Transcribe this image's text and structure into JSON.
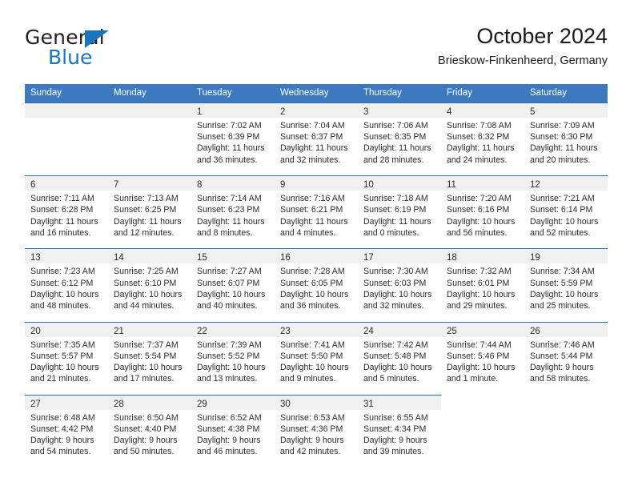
{
  "brand": {
    "name_top": "General",
    "name_bottom": "Blue",
    "triangle_color": "#1b75bb"
  },
  "header": {
    "title": "October 2024",
    "subtitle": "Brieskow-Finkenheerd, Germany"
  },
  "theme": {
    "header_blue": "#3c79bf",
    "row_border_blue": "#2f6cb2",
    "day_bar_gray": "#f0f0f0",
    "text": "#2b2b2b"
  },
  "weekdays": [
    "Sunday",
    "Monday",
    "Tuesday",
    "Wednesday",
    "Thursday",
    "Friday",
    "Saturday"
  ],
  "labels": {
    "sunrise_prefix": "Sunrise: ",
    "sunset_prefix": "Sunset: ",
    "daylight_prefix": "Daylight: "
  },
  "weeks": [
    [
      {
        "day": "",
        "blank": true
      },
      {
        "day": "",
        "blank": true
      },
      {
        "day": "1",
        "sunrise": "Sunrise: 7:02 AM",
        "sunset": "Sunset: 6:39 PM",
        "daylight_1": "Daylight: 11 hours",
        "daylight_2": "and 36 minutes."
      },
      {
        "day": "2",
        "sunrise": "Sunrise: 7:04 AM",
        "sunset": "Sunset: 6:37 PM",
        "daylight_1": "Daylight: 11 hours",
        "daylight_2": "and 32 minutes."
      },
      {
        "day": "3",
        "sunrise": "Sunrise: 7:06 AM",
        "sunset": "Sunset: 6:35 PM",
        "daylight_1": "Daylight: 11 hours",
        "daylight_2": "and 28 minutes."
      },
      {
        "day": "4",
        "sunrise": "Sunrise: 7:08 AM",
        "sunset": "Sunset: 6:32 PM",
        "daylight_1": "Daylight: 11 hours",
        "daylight_2": "and 24 minutes."
      },
      {
        "day": "5",
        "sunrise": "Sunrise: 7:09 AM",
        "sunset": "Sunset: 6:30 PM",
        "daylight_1": "Daylight: 11 hours",
        "daylight_2": "and 20 minutes."
      }
    ],
    [
      {
        "day": "6",
        "sunrise": "Sunrise: 7:11 AM",
        "sunset": "Sunset: 6:28 PM",
        "daylight_1": "Daylight: 11 hours",
        "daylight_2": "and 16 minutes."
      },
      {
        "day": "7",
        "sunrise": "Sunrise: 7:13 AM",
        "sunset": "Sunset: 6:25 PM",
        "daylight_1": "Daylight: 11 hours",
        "daylight_2": "and 12 minutes."
      },
      {
        "day": "8",
        "sunrise": "Sunrise: 7:14 AM",
        "sunset": "Sunset: 6:23 PM",
        "daylight_1": "Daylight: 11 hours",
        "daylight_2": "and 8 minutes."
      },
      {
        "day": "9",
        "sunrise": "Sunrise: 7:16 AM",
        "sunset": "Sunset: 6:21 PM",
        "daylight_1": "Daylight: 11 hours",
        "daylight_2": "and 4 minutes."
      },
      {
        "day": "10",
        "sunrise": "Sunrise: 7:18 AM",
        "sunset": "Sunset: 6:19 PM",
        "daylight_1": "Daylight: 11 hours",
        "daylight_2": "and 0 minutes."
      },
      {
        "day": "11",
        "sunrise": "Sunrise: 7:20 AM",
        "sunset": "Sunset: 6:16 PM",
        "daylight_1": "Daylight: 10 hours",
        "daylight_2": "and 56 minutes."
      },
      {
        "day": "12",
        "sunrise": "Sunrise: 7:21 AM",
        "sunset": "Sunset: 6:14 PM",
        "daylight_1": "Daylight: 10 hours",
        "daylight_2": "and 52 minutes."
      }
    ],
    [
      {
        "day": "13",
        "sunrise": "Sunrise: 7:23 AM",
        "sunset": "Sunset: 6:12 PM",
        "daylight_1": "Daylight: 10 hours",
        "daylight_2": "and 48 minutes."
      },
      {
        "day": "14",
        "sunrise": "Sunrise: 7:25 AM",
        "sunset": "Sunset: 6:10 PM",
        "daylight_1": "Daylight: 10 hours",
        "daylight_2": "and 44 minutes."
      },
      {
        "day": "15",
        "sunrise": "Sunrise: 7:27 AM",
        "sunset": "Sunset: 6:07 PM",
        "daylight_1": "Daylight: 10 hours",
        "daylight_2": "and 40 minutes."
      },
      {
        "day": "16",
        "sunrise": "Sunrise: 7:28 AM",
        "sunset": "Sunset: 6:05 PM",
        "daylight_1": "Daylight: 10 hours",
        "daylight_2": "and 36 minutes."
      },
      {
        "day": "17",
        "sunrise": "Sunrise: 7:30 AM",
        "sunset": "Sunset: 6:03 PM",
        "daylight_1": "Daylight: 10 hours",
        "daylight_2": "and 32 minutes."
      },
      {
        "day": "18",
        "sunrise": "Sunrise: 7:32 AM",
        "sunset": "Sunset: 6:01 PM",
        "daylight_1": "Daylight: 10 hours",
        "daylight_2": "and 29 minutes."
      },
      {
        "day": "19",
        "sunrise": "Sunrise: 7:34 AM",
        "sunset": "Sunset: 5:59 PM",
        "daylight_1": "Daylight: 10 hours",
        "daylight_2": "and 25 minutes."
      }
    ],
    [
      {
        "day": "20",
        "sunrise": "Sunrise: 7:35 AM",
        "sunset": "Sunset: 5:57 PM",
        "daylight_1": "Daylight: 10 hours",
        "daylight_2": "and 21 minutes."
      },
      {
        "day": "21",
        "sunrise": "Sunrise: 7:37 AM",
        "sunset": "Sunset: 5:54 PM",
        "daylight_1": "Daylight: 10 hours",
        "daylight_2": "and 17 minutes."
      },
      {
        "day": "22",
        "sunrise": "Sunrise: 7:39 AM",
        "sunset": "Sunset: 5:52 PM",
        "daylight_1": "Daylight: 10 hours",
        "daylight_2": "and 13 minutes."
      },
      {
        "day": "23",
        "sunrise": "Sunrise: 7:41 AM",
        "sunset": "Sunset: 5:50 PM",
        "daylight_1": "Daylight: 10 hours",
        "daylight_2": "and 9 minutes."
      },
      {
        "day": "24",
        "sunrise": "Sunrise: 7:42 AM",
        "sunset": "Sunset: 5:48 PM",
        "daylight_1": "Daylight: 10 hours",
        "daylight_2": "and 5 minutes."
      },
      {
        "day": "25",
        "sunrise": "Sunrise: 7:44 AM",
        "sunset": "Sunset: 5:46 PM",
        "daylight_1": "Daylight: 10 hours",
        "daylight_2": "and 1 minute."
      },
      {
        "day": "26",
        "sunrise": "Sunrise: 7:46 AM",
        "sunset": "Sunset: 5:44 PM",
        "daylight_1": "Daylight: 9 hours",
        "daylight_2": "and 58 minutes."
      }
    ],
    [
      {
        "day": "27",
        "sunrise": "Sunrise: 6:48 AM",
        "sunset": "Sunset: 4:42 PM",
        "daylight_1": "Daylight: 9 hours",
        "daylight_2": "and 54 minutes."
      },
      {
        "day": "28",
        "sunrise": "Sunrise: 6:50 AM",
        "sunset": "Sunset: 4:40 PM",
        "daylight_1": "Daylight: 9 hours",
        "daylight_2": "and 50 minutes."
      },
      {
        "day": "29",
        "sunrise": "Sunrise: 6:52 AM",
        "sunset": "Sunset: 4:38 PM",
        "daylight_1": "Daylight: 9 hours",
        "daylight_2": "and 46 minutes."
      },
      {
        "day": "30",
        "sunrise": "Sunrise: 6:53 AM",
        "sunset": "Sunset: 4:36 PM",
        "daylight_1": "Daylight: 9 hours",
        "daylight_2": "and 42 minutes."
      },
      {
        "day": "31",
        "sunrise": "Sunrise: 6:55 AM",
        "sunset": "Sunset: 4:34 PM",
        "daylight_1": "Daylight: 9 hours",
        "daylight_2": "and 39 minutes."
      },
      {
        "day": "",
        "blank": true,
        "tail": true
      },
      {
        "day": "",
        "blank": true,
        "tail": true
      }
    ]
  ]
}
